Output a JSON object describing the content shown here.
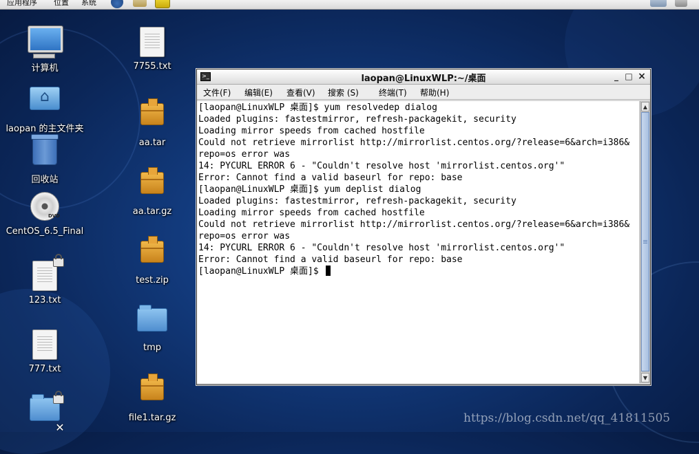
{
  "top_panel": {
    "menus": [
      "应用程序",
      "位置",
      "系统"
    ]
  },
  "desktop": {
    "icons": [
      {
        "label": "计算机",
        "icon": "computer-icon"
      },
      {
        "label": "laopan 的主文件夹",
        "icon": "home-folder-icon"
      },
      {
        "label": "回收站",
        "icon": "trash-icon"
      },
      {
        "label": "CentOS_6.5_Final",
        "icon": "dvd-icon"
      },
      {
        "label": "123.txt",
        "icon": "text-file-icon",
        "emblem": "lock-icon"
      },
      {
        "label": "777.txt",
        "icon": "text-file-icon"
      },
      {
        "label": "",
        "icon": "folder-icon",
        "emblem": "x-icon"
      },
      {
        "label": "7755.txt",
        "icon": "text-file-icon"
      },
      {
        "label": "aa.tar",
        "icon": "archive-icon"
      },
      {
        "label": "aa.tar.gz",
        "icon": "archive-icon"
      },
      {
        "label": "test.zip",
        "icon": "archive-icon"
      },
      {
        "label": "tmp",
        "icon": "folder-icon"
      },
      {
        "label": "file1.tar.gz",
        "icon": "archive-icon"
      }
    ]
  },
  "terminal": {
    "title": "laopan@LinuxWLP:~/桌面",
    "menu": [
      "文件(F)",
      "编辑(E)",
      "查看(V)",
      "搜索 (S)",
      "终端(T)",
      "帮助(H)"
    ],
    "lines": [
      "[laopan@LinuxWLP 桌面]$ yum resolvedep dialog",
      "Loaded plugins: fastestmirror, refresh-packagekit, security",
      "Loading mirror speeds from cached hostfile",
      "Could not retrieve mirrorlist http://mirrorlist.centos.org/?release=6&arch=i386&",
      "repo=os error was",
      "14: PYCURL ERROR 6 - \"Couldn't resolve host 'mirrorlist.centos.org'\"",
      "Error: Cannot find a valid baseurl for repo: base",
      "[laopan@LinuxWLP 桌面]$ yum deplist dialog",
      "Loaded plugins: fastestmirror, refresh-packagekit, security",
      "Loading mirror speeds from cached hostfile",
      "Could not retrieve mirrorlist http://mirrorlist.centos.org/?release=6&arch=i386&",
      "repo=os error was",
      "14: PYCURL ERROR 6 - \"Couldn't resolve host 'mirrorlist.centos.org'\"",
      "Error: Cannot find a valid baseurl for repo: base",
      "[laopan@LinuxWLP 桌面]$ "
    ]
  },
  "watermark": "https://blog.csdn.net/qq_41811505"
}
